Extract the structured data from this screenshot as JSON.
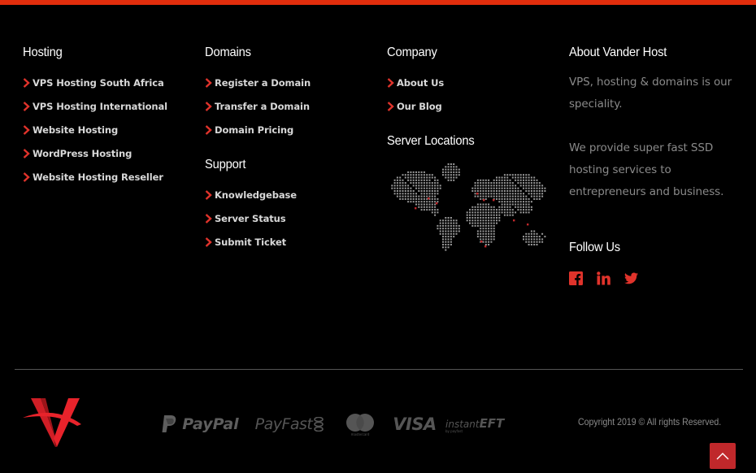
{
  "colors": {
    "accent": "#e12d0c",
    "icon_red": "#e0332b",
    "scroll_top_bg": "#c0282b",
    "background": "#000000"
  },
  "hosting": {
    "title": "Hosting",
    "links": [
      {
        "label": "VPS Hosting South Africa",
        "icon": "chevron-right-icon"
      },
      {
        "label": "VPS Hosting International",
        "icon": "chevron-right-icon"
      },
      {
        "label": "Website Hosting",
        "icon": "chevron-right-icon"
      },
      {
        "label": "WordPress Hosting",
        "icon": "chevron-right-icon"
      },
      {
        "label": "Website Hosting Reseller",
        "icon": "chevron-right-icon"
      }
    ]
  },
  "domains": {
    "title": "Domains",
    "links": [
      {
        "label": "Register a Domain",
        "icon": "chevron-right-icon"
      },
      {
        "label": "Transfer a Domain",
        "icon": "chevron-right-icon"
      },
      {
        "label": "Domain Pricing",
        "icon": "chevron-right-icon"
      }
    ]
  },
  "support": {
    "title": "Support",
    "links": [
      {
        "label": "Knowledgebase",
        "icon": "chevron-right-icon"
      },
      {
        "label": "Server Status",
        "icon": "chevron-right-icon"
      },
      {
        "label": "Submit Ticket",
        "icon": "chevron-right-icon"
      }
    ]
  },
  "company": {
    "title": "Company",
    "links": [
      {
        "label": "About Us",
        "icon": "chevron-right-icon"
      },
      {
        "label": "Our Blog",
        "icon": "chevron-right-icon"
      }
    ]
  },
  "server_locations": {
    "title": "Server Locations",
    "map_icon": "dotted-world-map"
  },
  "about": {
    "title": "About Vander Host",
    "paragraphs": [
      "VPS, hosting & domains is our speciality.",
      "We provide super fast SSD hosting services to entrepreneurs and business."
    ]
  },
  "follow": {
    "title": "Follow Us",
    "socials": [
      {
        "name": "facebook",
        "icon": "facebook-icon"
      },
      {
        "name": "linkedin",
        "icon": "linkedin-icon"
      },
      {
        "name": "twitter",
        "icon": "twitter-icon"
      }
    ]
  },
  "bottom": {
    "logo_icon": "vander-host-v-logo",
    "payments": {
      "paypal": "PayPal",
      "payfast": "PayFast",
      "mastercard": "mastercard",
      "visa": "VISA",
      "instant_eft_prefix": "instant",
      "instant_eft_suffix": "EFT",
      "instant_eft_sub": "by payfast"
    },
    "copyright": "Copyright 2019 © All rights Reserved.",
    "scroll_top_icon": "chevron-up-icon"
  }
}
